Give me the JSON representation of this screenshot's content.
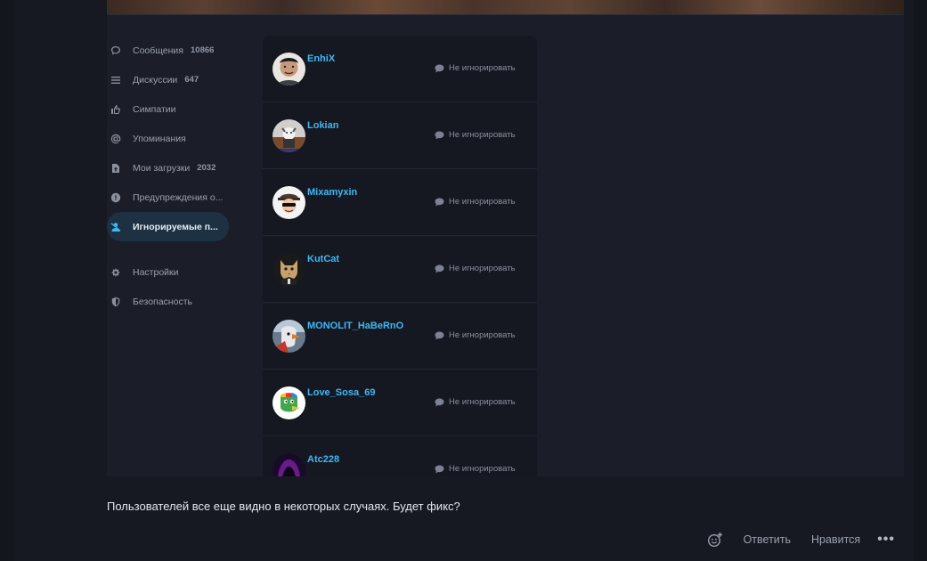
{
  "sidebar": {
    "items": [
      {
        "label": "Сообщения",
        "count": "10866",
        "icon": "speech-bubble-icon"
      },
      {
        "label": "Дискуссии",
        "count": "647",
        "icon": "list-icon"
      },
      {
        "label": "Симпатии",
        "count": "",
        "icon": "thumbs-up-icon"
      },
      {
        "label": "Упоминания",
        "count": "",
        "icon": "at-sign-icon"
      },
      {
        "label": "Мои загрузки",
        "count": "2032",
        "icon": "file-upload-icon"
      },
      {
        "label": "Предупреждения о...",
        "count": "",
        "icon": "alert-circle-icon"
      },
      {
        "label": "Игнорируемые п...",
        "count": "",
        "icon": "user-ignore-icon",
        "active": true
      },
      {
        "label": "Настройки",
        "count": "",
        "icon": "gear-icon"
      },
      {
        "label": "Безопасность",
        "count": "",
        "icon": "shield-icon"
      }
    ]
  },
  "ignored_users": {
    "action_label": "Не игнорировать",
    "users": [
      {
        "name": "EnhiX"
      },
      {
        "name": "Lokian"
      },
      {
        "name": "Mixamyxin"
      },
      {
        "name": "KutCat"
      },
      {
        "name": "MONOLIT_HaBeRnO"
      },
      {
        "name": "Love_Sosa_69"
      },
      {
        "name": "Atc228"
      }
    ]
  },
  "post": {
    "text": "Пользователей все еще видно в некоторых случаях. Будет фикс?",
    "reply_label": "Ответить",
    "like_label": "Нравится",
    "more_label": "•••"
  },
  "colors": {
    "accent": "#3fb8f4",
    "background": "#14161e",
    "panel": "#1b1e28"
  }
}
